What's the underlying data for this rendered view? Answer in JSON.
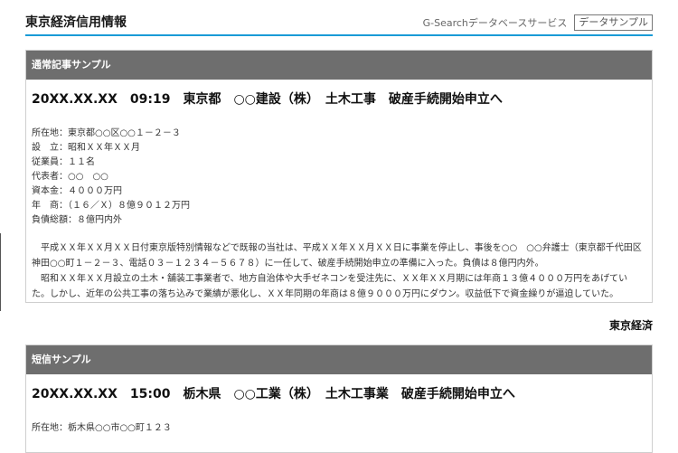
{
  "header": {
    "title": "東京経済信用情報",
    "service": "G-Searchデータベースサービス",
    "sample_tag": "データサンプル"
  },
  "article1": {
    "section_label": "通常記事サンプル",
    "headline": "20XX.XX.XX　09:19　東京都　○○建設（株）　土木工事　破産手続開始申立へ",
    "details": [
      "所在地：東京都○○区○○１－２－３",
      "設　立：昭和ＸＸ年ＸＸ月",
      "従業員：１１名",
      "代表者：○○　○○",
      "資本金：４０００万円",
      "年　商：（１６／Ｘ）８億９０１２万円",
      "負債総額：８億円内外"
    ],
    "paragraphs": [
      "平成ＸＸ年ＸＸ月ＸＸ日付東京版特別情報などで既報の当社は、平成ＸＸ年ＸＸ月ＸＸ日に事業を停止し、事後を○○　○○弁護士（東京都千代田区神田○○町１－２－３、電話０３－１２３４－５６７８）に一任して、破産手続開始申立の準備に入った。負債は８億円内外。",
      "昭和ＸＸ年ＸＸ月設立の土木・舗装工事業者で、地方自治体や大手ゼネコンを受注先に、ＸＸ年ＸＸ月期には年商１３億４０００万円をあげていた。しかし、近年の公共工事の落ち込みで業績が悪化し、ＸＸ年同期の年商は８億９０００万円にダウン。収益低下で資金繰りが逼迫していた。"
    ],
    "attribution": "東京経済"
  },
  "article2": {
    "section_label": "短信サンプル",
    "headline": "20XX.XX.XX　15:00　栃木県　○○工業（株）　土木工事業　破産手続開始申立へ",
    "details": [
      "所在地：栃木県○○市○○町１２３"
    ]
  }
}
